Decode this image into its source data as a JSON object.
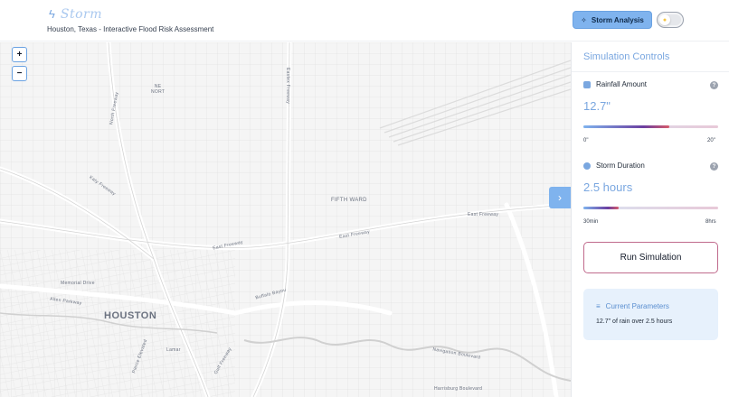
{
  "header": {
    "brand_icon": "bolt-icon",
    "title": "Storm",
    "subtitle": "Houston, Texas - Interactive Flood Risk Assessment",
    "storm_button_label": "Storm Analysis",
    "storm_button_icon": "sparkle-icon",
    "theme_toggle_icon": "sun-icon"
  },
  "map": {
    "zoom_in": "+",
    "zoom_out": "−",
    "collapse_icon": "›",
    "labels": {
      "ne_north": "NE\nNORT",
      "north_freeway": "North Freeway",
      "eastex_freeway": "Eastex Freeway",
      "fifth_ward": "FIFTH WARD",
      "east_freeway_right": "East Freeway",
      "east_freeway_mid": "East Freeway",
      "east_freeway_left": "East Freeway",
      "katy_freeway": "Katy Freeway",
      "memorial_drive": "Memorial Drive",
      "allen_parkway": "Allen Parkway",
      "houston": "HOUSTON",
      "buffalo_bayou": "Buffalo Bayou",
      "navigation_blvd": "Navigation Boulevard",
      "harrisburg": "Harrisburg Boulevard",
      "gulf_freeway": "Gulf Freeway",
      "lamar": "Lamar",
      "pierce_elevated": "Pierce Elevated"
    }
  },
  "panel": {
    "title": "Simulation Controls",
    "rainfall": {
      "label": "Rainfall Amount",
      "value": "12.7\"",
      "min_label": "0\"",
      "max_label": "20\"",
      "fraction": 0.635
    },
    "duration": {
      "label": "Storm Duration",
      "value": "2.5 hours",
      "min_label": "30min",
      "max_label": "8hrs",
      "fraction": 0.26
    },
    "help_glyph": "?",
    "run_button": "Run Simulation",
    "params": {
      "title": "Current Parameters",
      "text": "12.7\" of rain over 2.5 hours"
    }
  },
  "colors": {
    "accent": "#7fb3ee",
    "accent_text": "#7aa7e0",
    "run_border": "#c06a8c",
    "slider_start": "#7fb3ee",
    "slider_mid": "#6b3fa0",
    "slider_end": "#d65a6a"
  }
}
